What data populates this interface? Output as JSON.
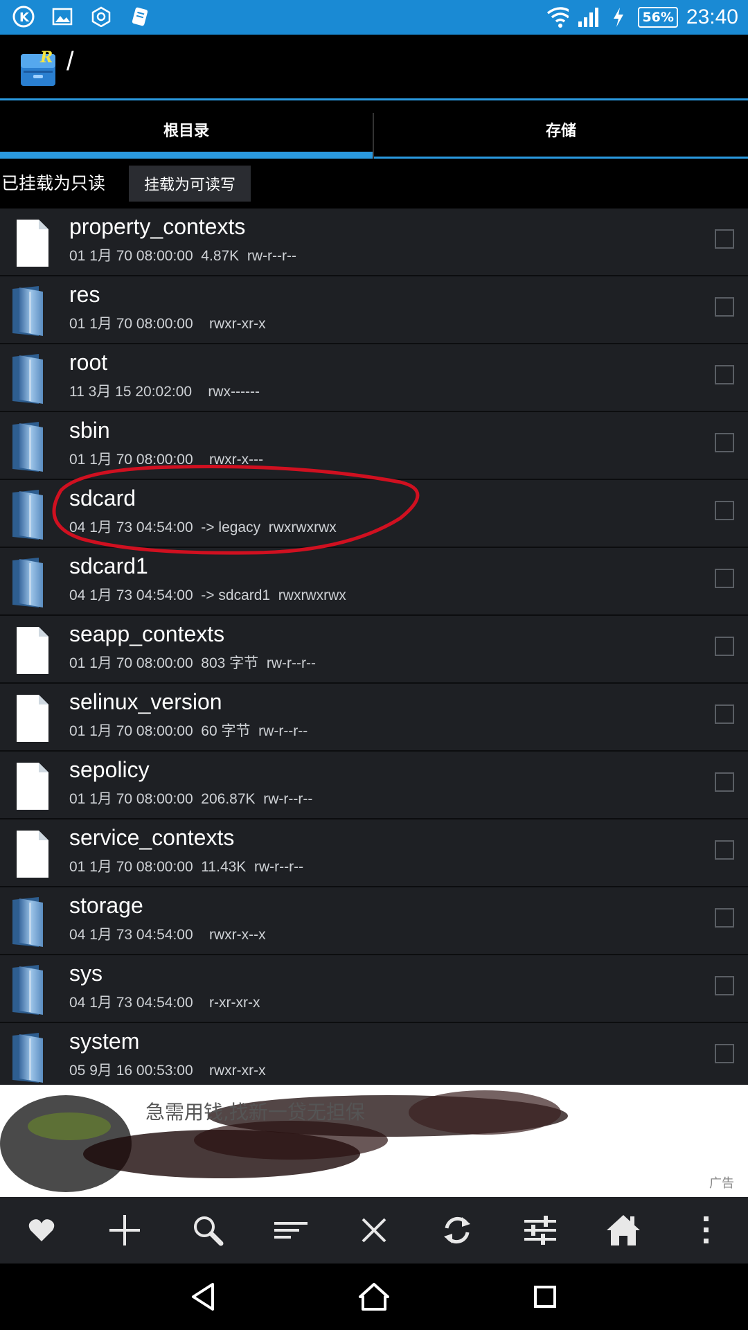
{
  "status_bar": {
    "battery": "56%",
    "time": "23:40"
  },
  "app_bar": {
    "path": "/"
  },
  "tabs": [
    {
      "label": "根目录",
      "selected": true
    },
    {
      "label": "存储",
      "selected": false
    }
  ],
  "mount": {
    "status_label": "已挂载为只读",
    "button_label": "挂载为可读写"
  },
  "files": [
    {
      "name": "property_contexts",
      "type": "file",
      "meta": "01 1月 70 08:00:00  4.87K  rw-r--r--"
    },
    {
      "name": "res",
      "type": "folder",
      "meta": "01 1月 70 08:00:00    rwxr-xr-x"
    },
    {
      "name": "root",
      "type": "folder",
      "meta": "11 3月 15 20:02:00    rwx------"
    },
    {
      "name": "sbin",
      "type": "folder",
      "meta": "01 1月 70 08:00:00    rwxr-x---"
    },
    {
      "name": "sdcard",
      "type": "folder",
      "meta": "04 1月 73 04:54:00  -> legacy  rwxrwxrwx"
    },
    {
      "name": "sdcard1",
      "type": "folder",
      "meta": "04 1月 73 04:54:00  -> sdcard1  rwxrwxrwx"
    },
    {
      "name": "seapp_contexts",
      "type": "file",
      "meta": "01 1月 70 08:00:00  803 字节  rw-r--r--"
    },
    {
      "name": "selinux_version",
      "type": "file",
      "meta": "01 1月 70 08:00:00  60 字节  rw-r--r--"
    },
    {
      "name": "sepolicy",
      "type": "file",
      "meta": "01 1月 70 08:00:00  206.87K  rw-r--r--"
    },
    {
      "name": "service_contexts",
      "type": "file",
      "meta": "01 1月 70 08:00:00  11.43K  rw-r--r--"
    },
    {
      "name": "storage",
      "type": "folder",
      "meta": "04 1月 73 04:54:00    rwxr-x--x"
    },
    {
      "name": "sys",
      "type": "folder",
      "meta": "04 1月 73 04:54:00    r-xr-xr-x"
    },
    {
      "name": "system",
      "type": "folder",
      "meta": "05 9月 16 00:53:00    rwxr-xr-x"
    }
  ],
  "ad": {
    "text": "急需用钱,找新一贷无担保",
    "label": "广告"
  },
  "toolbar": [
    "heart-icon",
    "plus-icon",
    "search-icon",
    "sort-icon",
    "close-icon",
    "refresh-icon",
    "sliders-icon",
    "home-icon",
    "more-icon"
  ],
  "nav": [
    "back-icon",
    "home-circle-icon",
    "recents-icon"
  ],
  "colors": {
    "accent": "#2a9ae0",
    "status_bar": "#1a8ad4",
    "list_bg": "#1e2024",
    "highlight": "#d01020"
  }
}
